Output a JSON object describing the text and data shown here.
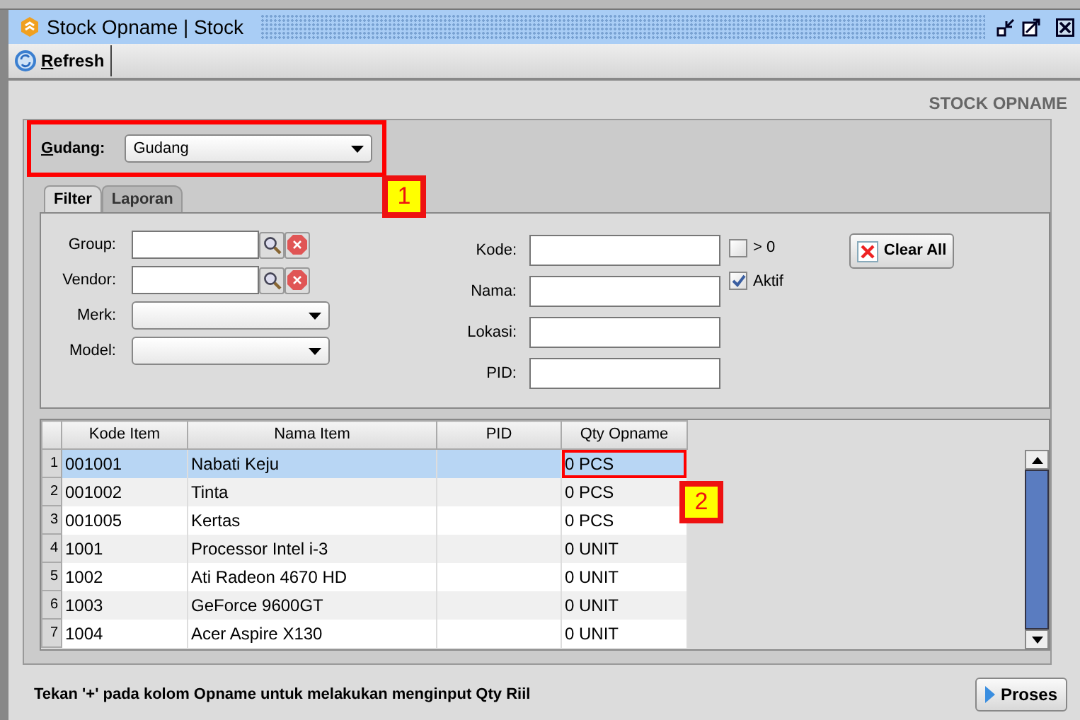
{
  "window": {
    "title": "Stock Opname | Stock"
  },
  "toolbar": [
    {
      "label": "Refresh"
    }
  ],
  "heading": "STOCK OPNAME",
  "gudang": {
    "label": "Gudang:",
    "value": "Gudang",
    "highlighted": true
  },
  "tabs": [
    {
      "label": "Filter",
      "selected": true
    },
    {
      "label": "Laporan",
      "selected": false
    }
  ],
  "filter_left": [
    {
      "label": "Group:",
      "kind": "lookup"
    },
    {
      "label": "Vendor:",
      "kind": "lookup"
    },
    {
      "label": "Merk:",
      "kind": "select"
    },
    {
      "label": "Model:",
      "kind": "select"
    }
  ],
  "filter_mid": [
    {
      "label": "Kode:"
    },
    {
      "label": "Nama:"
    },
    {
      "label": "Lokasi:"
    },
    {
      "label": "PID:"
    }
  ],
  "checkboxes": [
    {
      "label": "> 0",
      "checked": false
    },
    {
      "label": "Aktif",
      "checked": true
    }
  ],
  "clear_button": "Clear All",
  "table": {
    "columns": [
      "Kode Item",
      "Nama Item",
      "PID",
      "Qty Opname"
    ],
    "rows": [
      {
        "number": "1",
        "kode": "001001",
        "nama": "Nabati Keju",
        "qty": "0 PCS",
        "selected": true,
        "qty_highlighted": true
      },
      {
        "number": "2",
        "kode": "001002",
        "nama": "Tinta",
        "qty": "0 PCS",
        "selected": false,
        "qty_highlighted": false
      },
      {
        "number": "3",
        "kode": "001005",
        "nama": "Kertas",
        "qty": "0 PCS",
        "selected": false,
        "qty_highlighted": false
      },
      {
        "number": "4",
        "kode": "1001",
        "nama": "Processor Intel i-3",
        "qty": "0 UNIT",
        "selected": false,
        "qty_highlighted": false
      },
      {
        "number": "5",
        "kode": "1002",
        "nama": "Ati Radeon 4670 HD",
        "qty": "0 UNIT",
        "selected": false,
        "qty_highlighted": false
      },
      {
        "number": "6",
        "kode": "1003",
        "nama": "GeForce 9600GT",
        "qty": "0 UNIT",
        "selected": false,
        "qty_highlighted": false
      },
      {
        "number": "7",
        "kode": "1004",
        "nama": "Acer Aspire X130",
        "qty": "0 UNIT",
        "selected": false,
        "qty_highlighted": false
      }
    ]
  },
  "hint": "Tekan '+' pada kolom Opname untuk melakukan menginput Qty Riil",
  "proses_button": "Proses",
  "callouts": [
    {
      "label": "1",
      "kind": "gudang"
    },
    {
      "label": "2",
      "kind": "cell"
    }
  ]
}
